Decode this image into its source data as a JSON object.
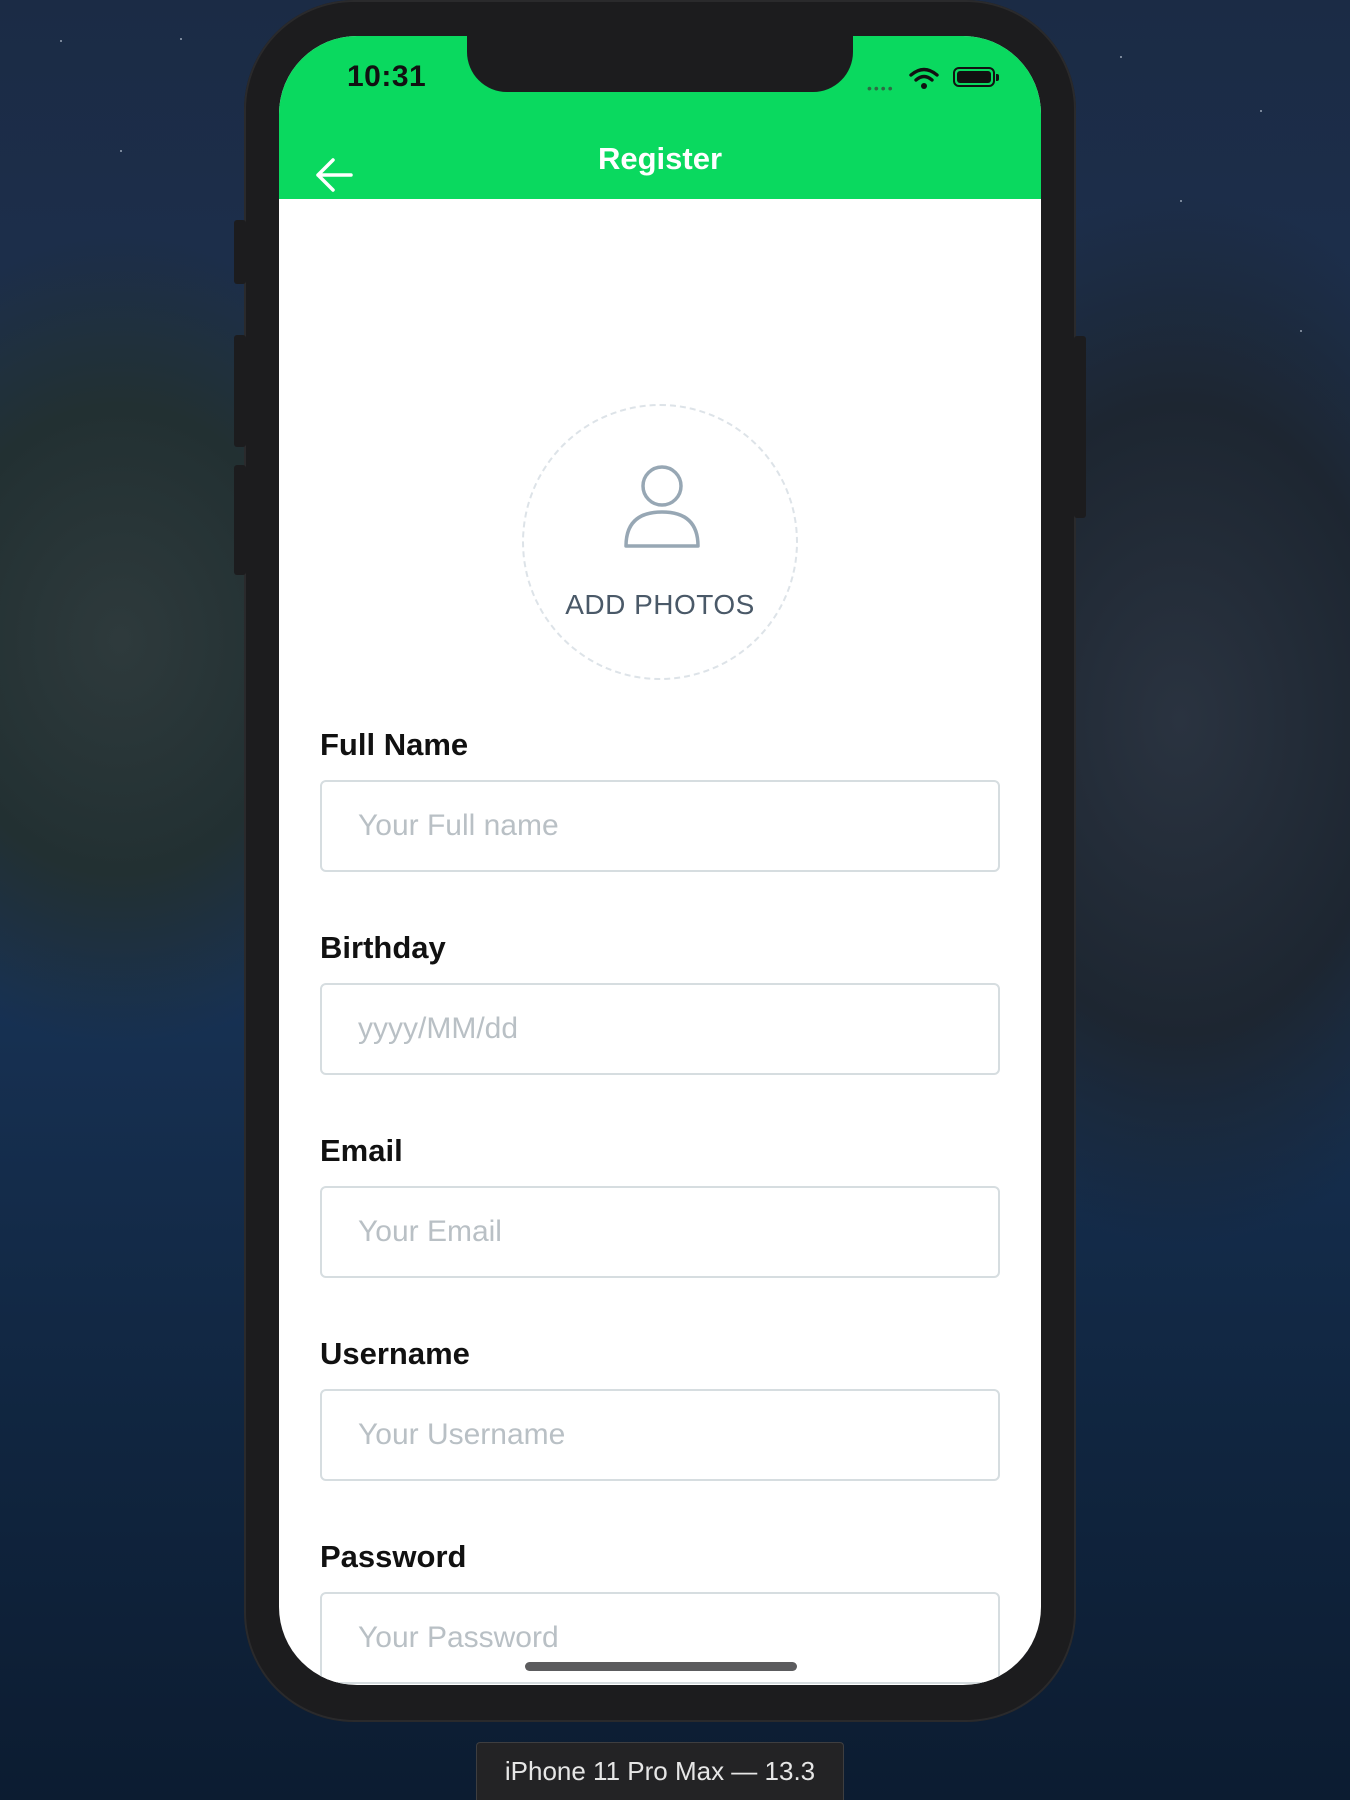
{
  "status_bar": {
    "time": "10:31"
  },
  "navbar": {
    "title": "Register",
    "background": "#0ad95f"
  },
  "photo_picker": {
    "label": "ADD PHOTOS",
    "icon": "person-icon"
  },
  "form": {
    "full_name": {
      "label": "Full Name",
      "placeholder": "Your Full name"
    },
    "birthday": {
      "label": "Birthday",
      "placeholder": "yyyy/MM/dd"
    },
    "email": {
      "label": "Email",
      "placeholder": "Your Email"
    },
    "username": {
      "label": "Username",
      "placeholder": "Your Username"
    },
    "password": {
      "label": "Password",
      "placeholder": "Your Password"
    }
  },
  "simulator": {
    "device_label": "iPhone 11 Pro Max — 13.3"
  }
}
